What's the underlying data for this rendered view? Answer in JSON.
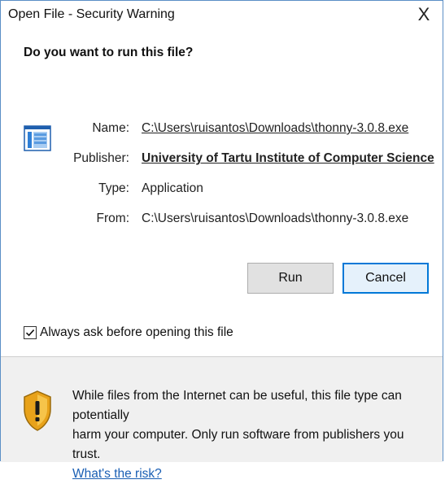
{
  "window": {
    "title": "Open File - Security Warning",
    "close_glyph": "X"
  },
  "question": "Do you want to run this file?",
  "file_icon": "application-window-icon",
  "details": {
    "name_label": "Name:",
    "name_value": "C:\\Users\\ruisantos\\Downloads\\thonny-3.0.8.exe",
    "publisher_label": "Publisher:",
    "publisher_value": "University of Tartu Institute of Computer Science",
    "type_label": "Type:",
    "type_value": "Application",
    "from_label": "From:",
    "from_value": "C:\\Users\\ruisantos\\Downloads\\thonny-3.0.8.exe"
  },
  "buttons": {
    "run": "Run",
    "cancel": "Cancel"
  },
  "checkbox": {
    "label": "Always ask before opening this file",
    "checked": true
  },
  "warning": {
    "icon": "shield-warning-icon",
    "line1": "While files from the Internet can be useful, this file type can potentially",
    "line2": "harm your computer. Only run software from publishers you trust.",
    "link": "What's the risk?"
  },
  "colors": {
    "link": "#1a5fb4",
    "accent": "#0078d7",
    "lower_panel": "#f0f0f0"
  }
}
